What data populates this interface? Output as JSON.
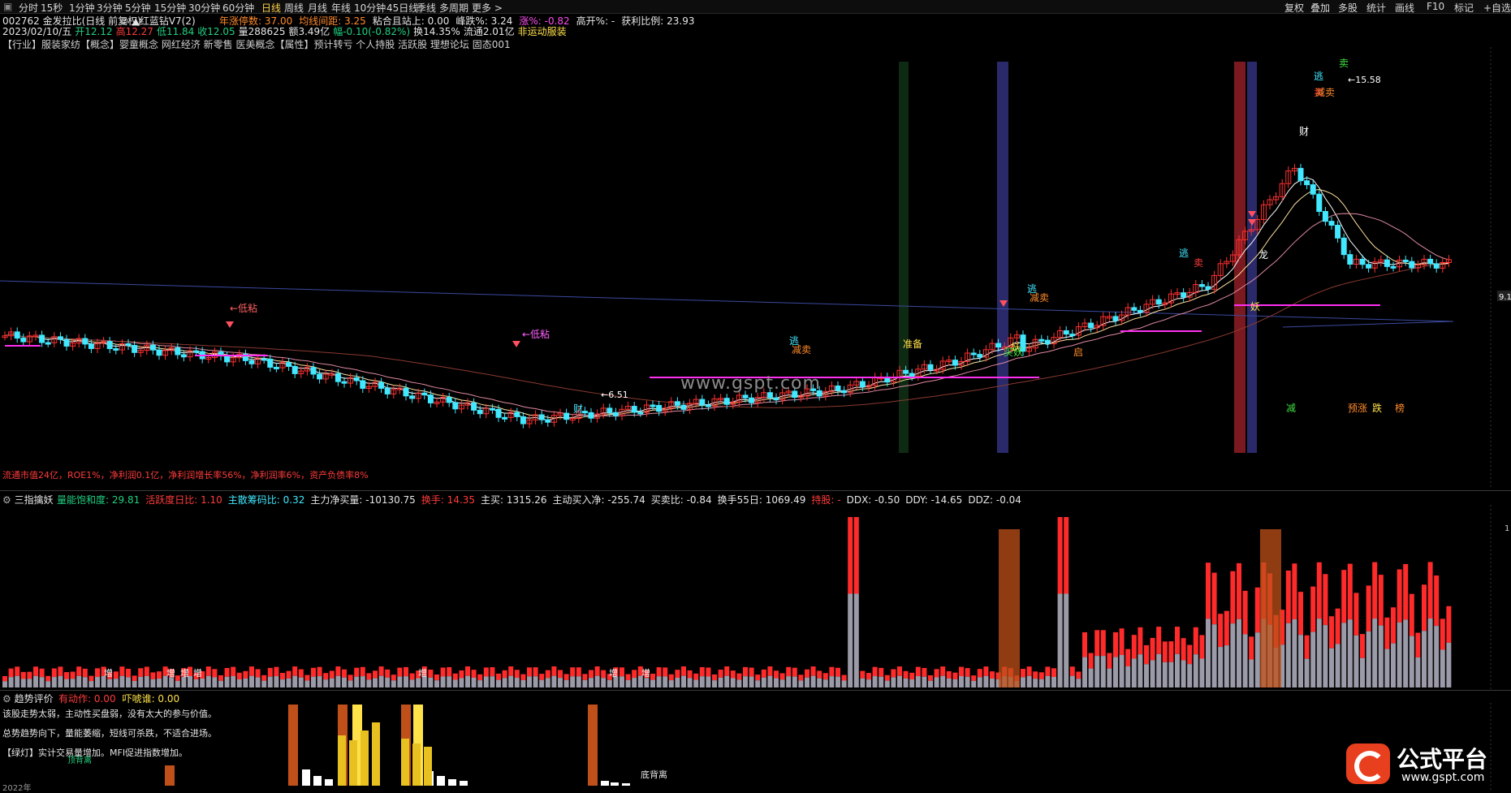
{
  "toolbar": {
    "tabs": [
      "分时",
      "15秒",
      "1分钟",
      "3分钟",
      "5分钟",
      "15分钟",
      "30分钟",
      "60分钟",
      "日线",
      "周线",
      "月线",
      "年线",
      "10分钟",
      "45日线",
      "季线",
      "多周期",
      "更多 >"
    ],
    "active": "日线",
    "right": [
      "复权",
      "叠加",
      "多股",
      "统计",
      "画线",
      "F10",
      "标记",
      "+自选"
    ]
  },
  "header": {
    "stock": "002762 金发拉比(日线 前复权)",
    "indicator": "▲红蓝钻V7(2)",
    "items": [
      {
        "t": "年涨停数: 37.00",
        "c": "o"
      },
      {
        "t": "均线间距: 3.25",
        "c": "o"
      },
      {
        "t": "粘合且站上: 0.00",
        "c": "w"
      },
      {
        "t": "峰跌%: 3.24",
        "c": "w"
      },
      {
        "t": "涨%: -0.82",
        "c": "m"
      },
      {
        "t": "高开%: -",
        "c": "w"
      },
      {
        "t": "获利比例: 23.93",
        "c": "w"
      }
    ],
    "row2": [
      {
        "t": "2023/02/10/五",
        "c": "w"
      },
      {
        "t": "开12.12",
        "c": "g"
      },
      {
        "t": "高12.27",
        "c": "r"
      },
      {
        "t": "低11.84",
        "c": "g"
      },
      {
        "t": "收12.05",
        "c": "g"
      },
      {
        "t": "量288625",
        "c": "w"
      },
      {
        "t": "额3.49亿",
        "c": "w"
      },
      {
        "t": "幅-0.10(-0.82%)",
        "c": "g"
      },
      {
        "t": "换14.35%",
        "c": "w"
      },
      {
        "t": "流通2.01亿",
        "c": "w"
      },
      {
        "t": "非运动服装",
        "c": "y"
      }
    ],
    "row3": "【行业】服装家纺【概念】婴童概念 网红经济 新零售 医美概念【属性】预计转亏 个人持股 活跃股 理想论坛 固态001"
  },
  "main_chart": {
    "watermark": "www.gspt.com",
    "labels": {
      "low1": "←低粘",
      "low2": "←低粘",
      "price_low": "←6.51",
      "price_high": "←15.58",
      "cai": "财",
      "zhunbei": "准备",
      "tao1": "逃",
      "tao2": "逃",
      "tao3": "逃",
      "tao4": "逃",
      "mai1": "卖",
      "mai2": "卖",
      "mai3": "卖",
      "jianmai1": "减卖",
      "jianmai2": "减卖",
      "jianmai3": "减卖",
      "yao1": "妖",
      "yao2": "妖",
      "long": "龙",
      "maiyao": "买妖",
      "qi": "启",
      "cai2": "财",
      "bottom_tags": [
        "减",
        "预涨",
        "跌",
        "榜"
      ]
    },
    "right_price": "9.1",
    "fundamentals": "流通市值24亿，ROE1%，净利润0.1亿，净利润增长率56%，净利润率6%，资产负债率8%"
  },
  "panel2": {
    "title": "三指擒妖",
    "items": [
      {
        "t": "量能饱和度: 29.81",
        "c": "g"
      },
      {
        "t": "活跃度日比: 1.10",
        "c": "r"
      },
      {
        "t": "主散筹码比: 0.32",
        "c": "c"
      },
      {
        "t": "主力净买量: -10130.75",
        "c": "w"
      },
      {
        "t": "换手: 14.35",
        "c": "r"
      },
      {
        "t": "主买: 1315.26",
        "c": "w"
      },
      {
        "t": "主动买入净: -255.74",
        "c": "w"
      },
      {
        "t": "买卖比: -0.84",
        "c": "w"
      },
      {
        "t": "换手55日: 1069.49",
        "c": "w"
      },
      {
        "t": "持股: -",
        "c": "r"
      },
      {
        "t": "DDX: -0.50",
        "c": "w"
      },
      {
        "t": "DDY: -14.65",
        "c": "w"
      },
      {
        "t": "DDZ: -0.04",
        "c": "w"
      }
    ],
    "right_tick": "1",
    "tags": [
      "增",
      "增",
      "增",
      "增",
      "增",
      "增",
      "增"
    ]
  },
  "panel3": {
    "title": "趋势评价",
    "items": [
      {
        "t": "有动作: 0.00",
        "c": "r"
      },
      {
        "t": "吓唬谁: 0.00",
        "c": "y"
      }
    ],
    "notes": [
      "该股走势太弱，主动性买盘弱，没有太大的参与价值。",
      "总势趋势向下，量能萎缩，短线可杀跌，不适合进场。",
      "【绿灯】实计交易量增加。MFI促进指数增加。"
    ],
    "label_bottom": "底背离",
    "label_green": "顶背离",
    "axis_year": "2022年"
  },
  "logo": {
    "text": "公式平台",
    "url": "www.gspt.com"
  },
  "colors": {
    "up": "#ff3030",
    "down": "#41e8ff",
    "ma1": "#ffffff",
    "ma2": "#ffe14a",
    "ma3": "#ff80c0",
    "ma4": "#7a3a2a",
    "magenta": "#ff30f0",
    "blue_line": "#5060c0"
  }
}
